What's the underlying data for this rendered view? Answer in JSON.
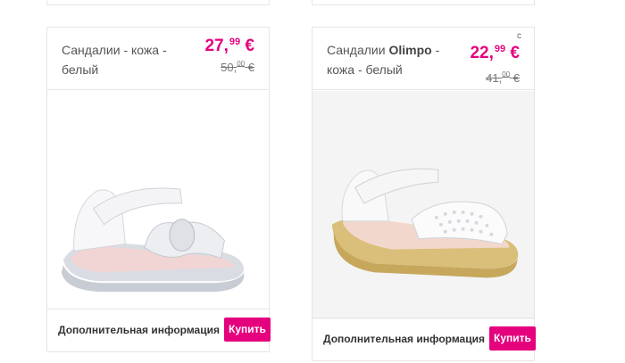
{
  "products": [
    {
      "title": "Сандалии - кожа - белый",
      "brand": "",
      "price_new": "27,",
      "price_new_cents": "99",
      "price_new_currency": "€",
      "price_old": "50,",
      "price_old_cents": "00",
      "price_old_currency": "€",
      "more_info": "Дополнительная информация",
      "buy_label": "Купить"
    },
    {
      "title_prefix": "Сандалии ",
      "brand": "Olimpo",
      "title_suffix": " - кожа - белый",
      "corner_mark": "с",
      "price_new": "22,",
      "price_new_cents": "99",
      "price_new_currency": "€",
      "price_old": "41,",
      "price_old_cents": "00",
      "price_old_currency": "€",
      "more_info": "Дополнительная информация",
      "buy_label": "Купить"
    }
  ],
  "colors": {
    "accent": "#e5007e",
    "border": "#e6e6e6"
  }
}
